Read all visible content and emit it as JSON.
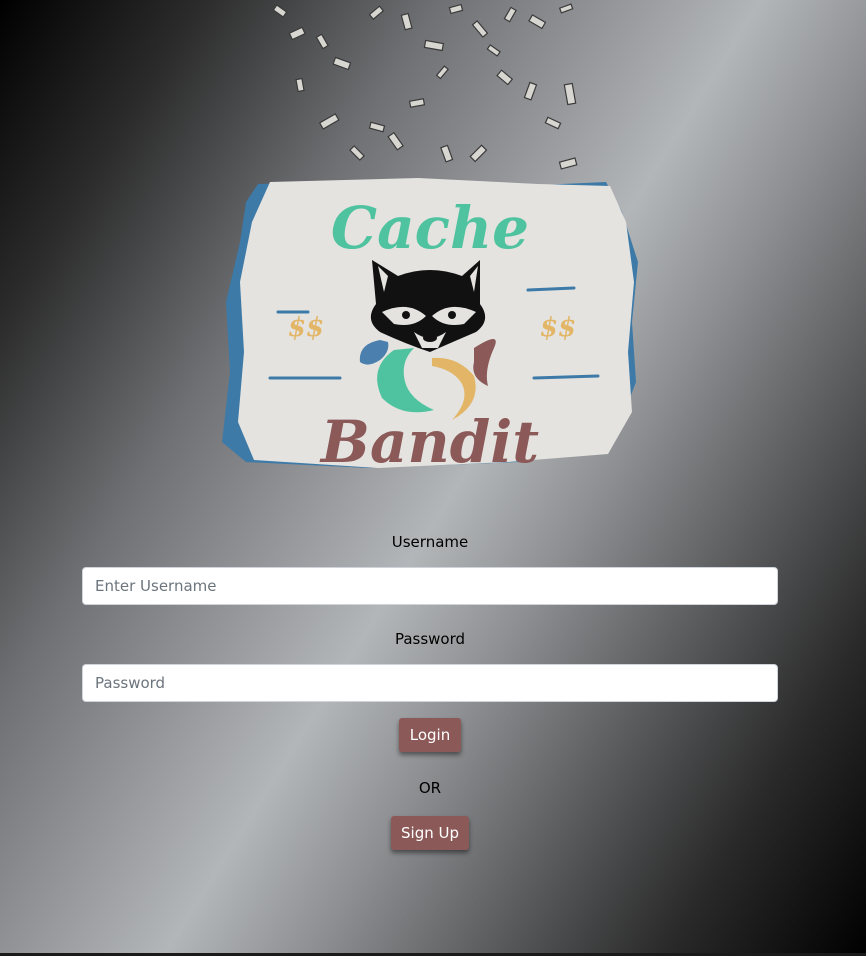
{
  "logo": {
    "title_top": "Cache",
    "title_bottom": "Bandit",
    "left_symbol": "$$",
    "right_symbol": "$$",
    "mascot_icon": "raccoon-icon",
    "colors": {
      "cache_text": "#4fc39f",
      "bandit_text": "#8b5a58",
      "dollar_signs": "#e3b667",
      "card_bg": "#e4e3e0",
      "card_edge": "#3d7aa8",
      "swirl_blue": "#4a7fae",
      "swirl_green": "#4fc39f",
      "swirl_tan": "#e3b667",
      "swirl_rose": "#8b5a58"
    }
  },
  "form": {
    "username_label": "Username",
    "username_placeholder": "Enter Username",
    "password_label": "Password",
    "password_placeholder": "Password",
    "login_button": "Login",
    "or_text": "OR",
    "signup_button": "Sign Up"
  },
  "decor": {
    "background_icon": "falling-money-icon",
    "button_color": "#8b5a58"
  }
}
